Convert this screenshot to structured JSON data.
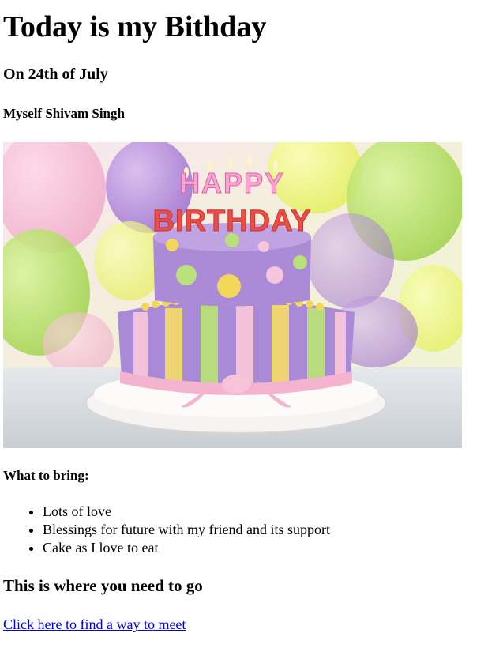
{
  "heading": "Today is my Bithday",
  "date_line": "On 24th of July",
  "name_line": "Myself Shivam Singh",
  "image": {
    "cake_text_top": "HAPPY",
    "cake_text_bottom": "BIRTHDAY",
    "icon": "birthday-cake-photo"
  },
  "bring_heading": "What to bring:",
  "bring_items": [
    "Lots of love",
    "Blessings for future with my friend and its support",
    "Cake as I love to eat"
  ],
  "where_heading": "This is where you need to go",
  "link_text": "Click here to find a way to meet",
  "colors": {
    "link": "#0000ee"
  }
}
